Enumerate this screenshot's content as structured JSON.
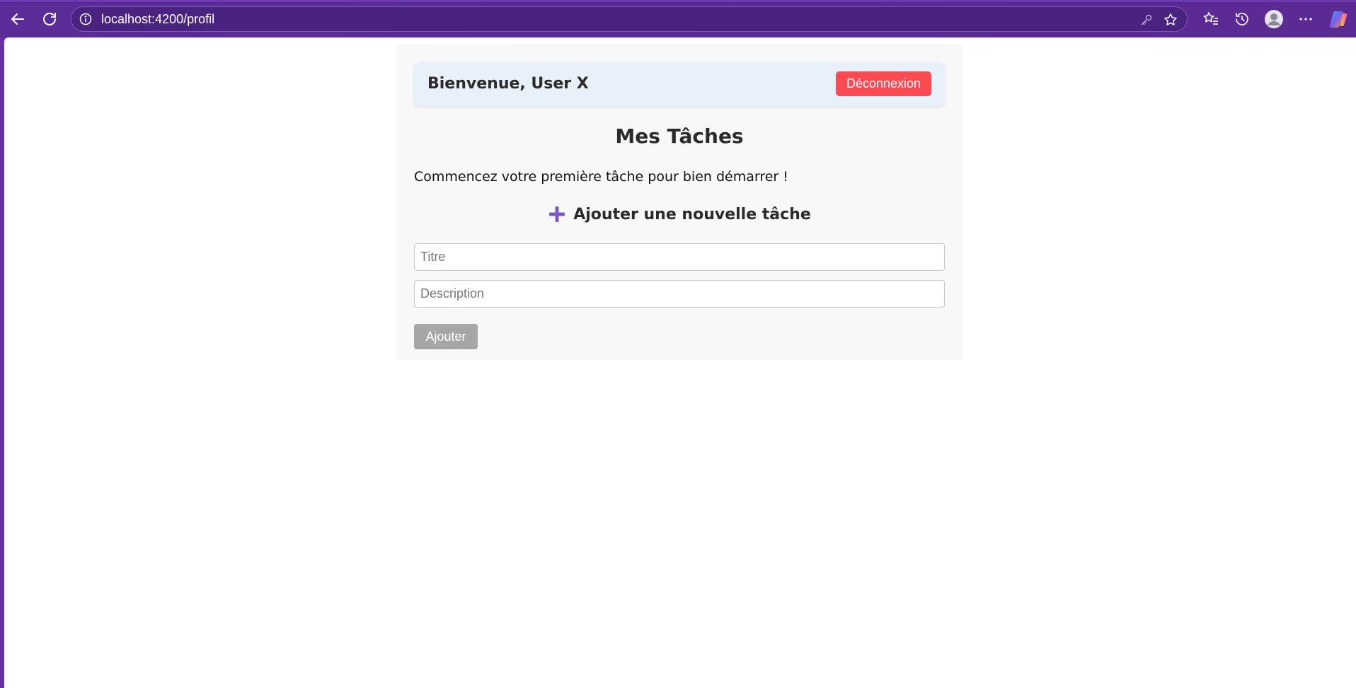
{
  "browser": {
    "url": "localhost:4200/profil",
    "icons": {
      "back": "back-arrow-icon",
      "refresh": "refresh-icon",
      "site_info": "info-icon",
      "password": "key-icon",
      "favorite": "star-icon",
      "favorites": "favorites-icon",
      "history": "history-icon",
      "profile": "avatar-icon",
      "more": "more-icon",
      "copilot": "copilot-icon"
    },
    "colors": {
      "frame": "#5b2a93"
    }
  },
  "header": {
    "welcome": "Bienvenue, User X",
    "logout_label": "Déconnexion"
  },
  "main": {
    "title": "Mes Tâches",
    "intro": "Commencez votre première tâche pour bien démarrer !",
    "add_heading": "Ajouter une nouvelle tâche",
    "title_placeholder": "Titre",
    "description_placeholder": "Description",
    "add_label": "Ajouter"
  },
  "colors": {
    "logout": "#ff4a52",
    "add_button": "#a6a6a6",
    "accent_plus": "#7b5bc2",
    "header_bg": "#e8f0fa"
  }
}
